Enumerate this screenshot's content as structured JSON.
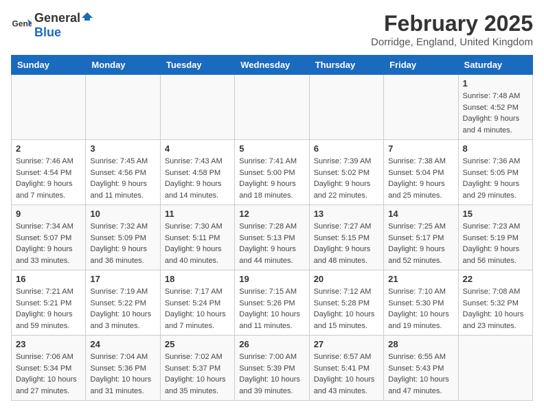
{
  "logo": {
    "general": "General",
    "blue": "Blue"
  },
  "title": "February 2025",
  "subtitle": "Dorridge, England, United Kingdom",
  "headers": [
    "Sunday",
    "Monday",
    "Tuesday",
    "Wednesday",
    "Thursday",
    "Friday",
    "Saturday"
  ],
  "weeks": [
    [
      {
        "day": "",
        "info": ""
      },
      {
        "day": "",
        "info": ""
      },
      {
        "day": "",
        "info": ""
      },
      {
        "day": "",
        "info": ""
      },
      {
        "day": "",
        "info": ""
      },
      {
        "day": "",
        "info": ""
      },
      {
        "day": "1",
        "info": "Sunrise: 7:48 AM\nSunset: 4:52 PM\nDaylight: 9 hours and 4 minutes."
      }
    ],
    [
      {
        "day": "2",
        "info": "Sunrise: 7:46 AM\nSunset: 4:54 PM\nDaylight: 9 hours and 7 minutes."
      },
      {
        "day": "3",
        "info": "Sunrise: 7:45 AM\nSunset: 4:56 PM\nDaylight: 9 hours and 11 minutes."
      },
      {
        "day": "4",
        "info": "Sunrise: 7:43 AM\nSunset: 4:58 PM\nDaylight: 9 hours and 14 minutes."
      },
      {
        "day": "5",
        "info": "Sunrise: 7:41 AM\nSunset: 5:00 PM\nDaylight: 9 hours and 18 minutes."
      },
      {
        "day": "6",
        "info": "Sunrise: 7:39 AM\nSunset: 5:02 PM\nDaylight: 9 hours and 22 minutes."
      },
      {
        "day": "7",
        "info": "Sunrise: 7:38 AM\nSunset: 5:04 PM\nDaylight: 9 hours and 25 minutes."
      },
      {
        "day": "8",
        "info": "Sunrise: 7:36 AM\nSunset: 5:05 PM\nDaylight: 9 hours and 29 minutes."
      }
    ],
    [
      {
        "day": "9",
        "info": "Sunrise: 7:34 AM\nSunset: 5:07 PM\nDaylight: 9 hours and 33 minutes."
      },
      {
        "day": "10",
        "info": "Sunrise: 7:32 AM\nSunset: 5:09 PM\nDaylight: 9 hours and 36 minutes."
      },
      {
        "day": "11",
        "info": "Sunrise: 7:30 AM\nSunset: 5:11 PM\nDaylight: 9 hours and 40 minutes."
      },
      {
        "day": "12",
        "info": "Sunrise: 7:28 AM\nSunset: 5:13 PM\nDaylight: 9 hours and 44 minutes."
      },
      {
        "day": "13",
        "info": "Sunrise: 7:27 AM\nSunset: 5:15 PM\nDaylight: 9 hours and 48 minutes."
      },
      {
        "day": "14",
        "info": "Sunrise: 7:25 AM\nSunset: 5:17 PM\nDaylight: 9 hours and 52 minutes."
      },
      {
        "day": "15",
        "info": "Sunrise: 7:23 AM\nSunset: 5:19 PM\nDaylight: 9 hours and 56 minutes."
      }
    ],
    [
      {
        "day": "16",
        "info": "Sunrise: 7:21 AM\nSunset: 5:21 PM\nDaylight: 9 hours and 59 minutes."
      },
      {
        "day": "17",
        "info": "Sunrise: 7:19 AM\nSunset: 5:22 PM\nDaylight: 10 hours and 3 minutes."
      },
      {
        "day": "18",
        "info": "Sunrise: 7:17 AM\nSunset: 5:24 PM\nDaylight: 10 hours and 7 minutes."
      },
      {
        "day": "19",
        "info": "Sunrise: 7:15 AM\nSunset: 5:26 PM\nDaylight: 10 hours and 11 minutes."
      },
      {
        "day": "20",
        "info": "Sunrise: 7:12 AM\nSunset: 5:28 PM\nDaylight: 10 hours and 15 minutes."
      },
      {
        "day": "21",
        "info": "Sunrise: 7:10 AM\nSunset: 5:30 PM\nDaylight: 10 hours and 19 minutes."
      },
      {
        "day": "22",
        "info": "Sunrise: 7:08 AM\nSunset: 5:32 PM\nDaylight: 10 hours and 23 minutes."
      }
    ],
    [
      {
        "day": "23",
        "info": "Sunrise: 7:06 AM\nSunset: 5:34 PM\nDaylight: 10 hours and 27 minutes."
      },
      {
        "day": "24",
        "info": "Sunrise: 7:04 AM\nSunset: 5:36 PM\nDaylight: 10 hours and 31 minutes."
      },
      {
        "day": "25",
        "info": "Sunrise: 7:02 AM\nSunset: 5:37 PM\nDaylight: 10 hours and 35 minutes."
      },
      {
        "day": "26",
        "info": "Sunrise: 7:00 AM\nSunset: 5:39 PM\nDaylight: 10 hours and 39 minutes."
      },
      {
        "day": "27",
        "info": "Sunrise: 6:57 AM\nSunset: 5:41 PM\nDaylight: 10 hours and 43 minutes."
      },
      {
        "day": "28",
        "info": "Sunrise: 6:55 AM\nSunset: 5:43 PM\nDaylight: 10 hours and 47 minutes."
      },
      {
        "day": "",
        "info": ""
      }
    ]
  ]
}
